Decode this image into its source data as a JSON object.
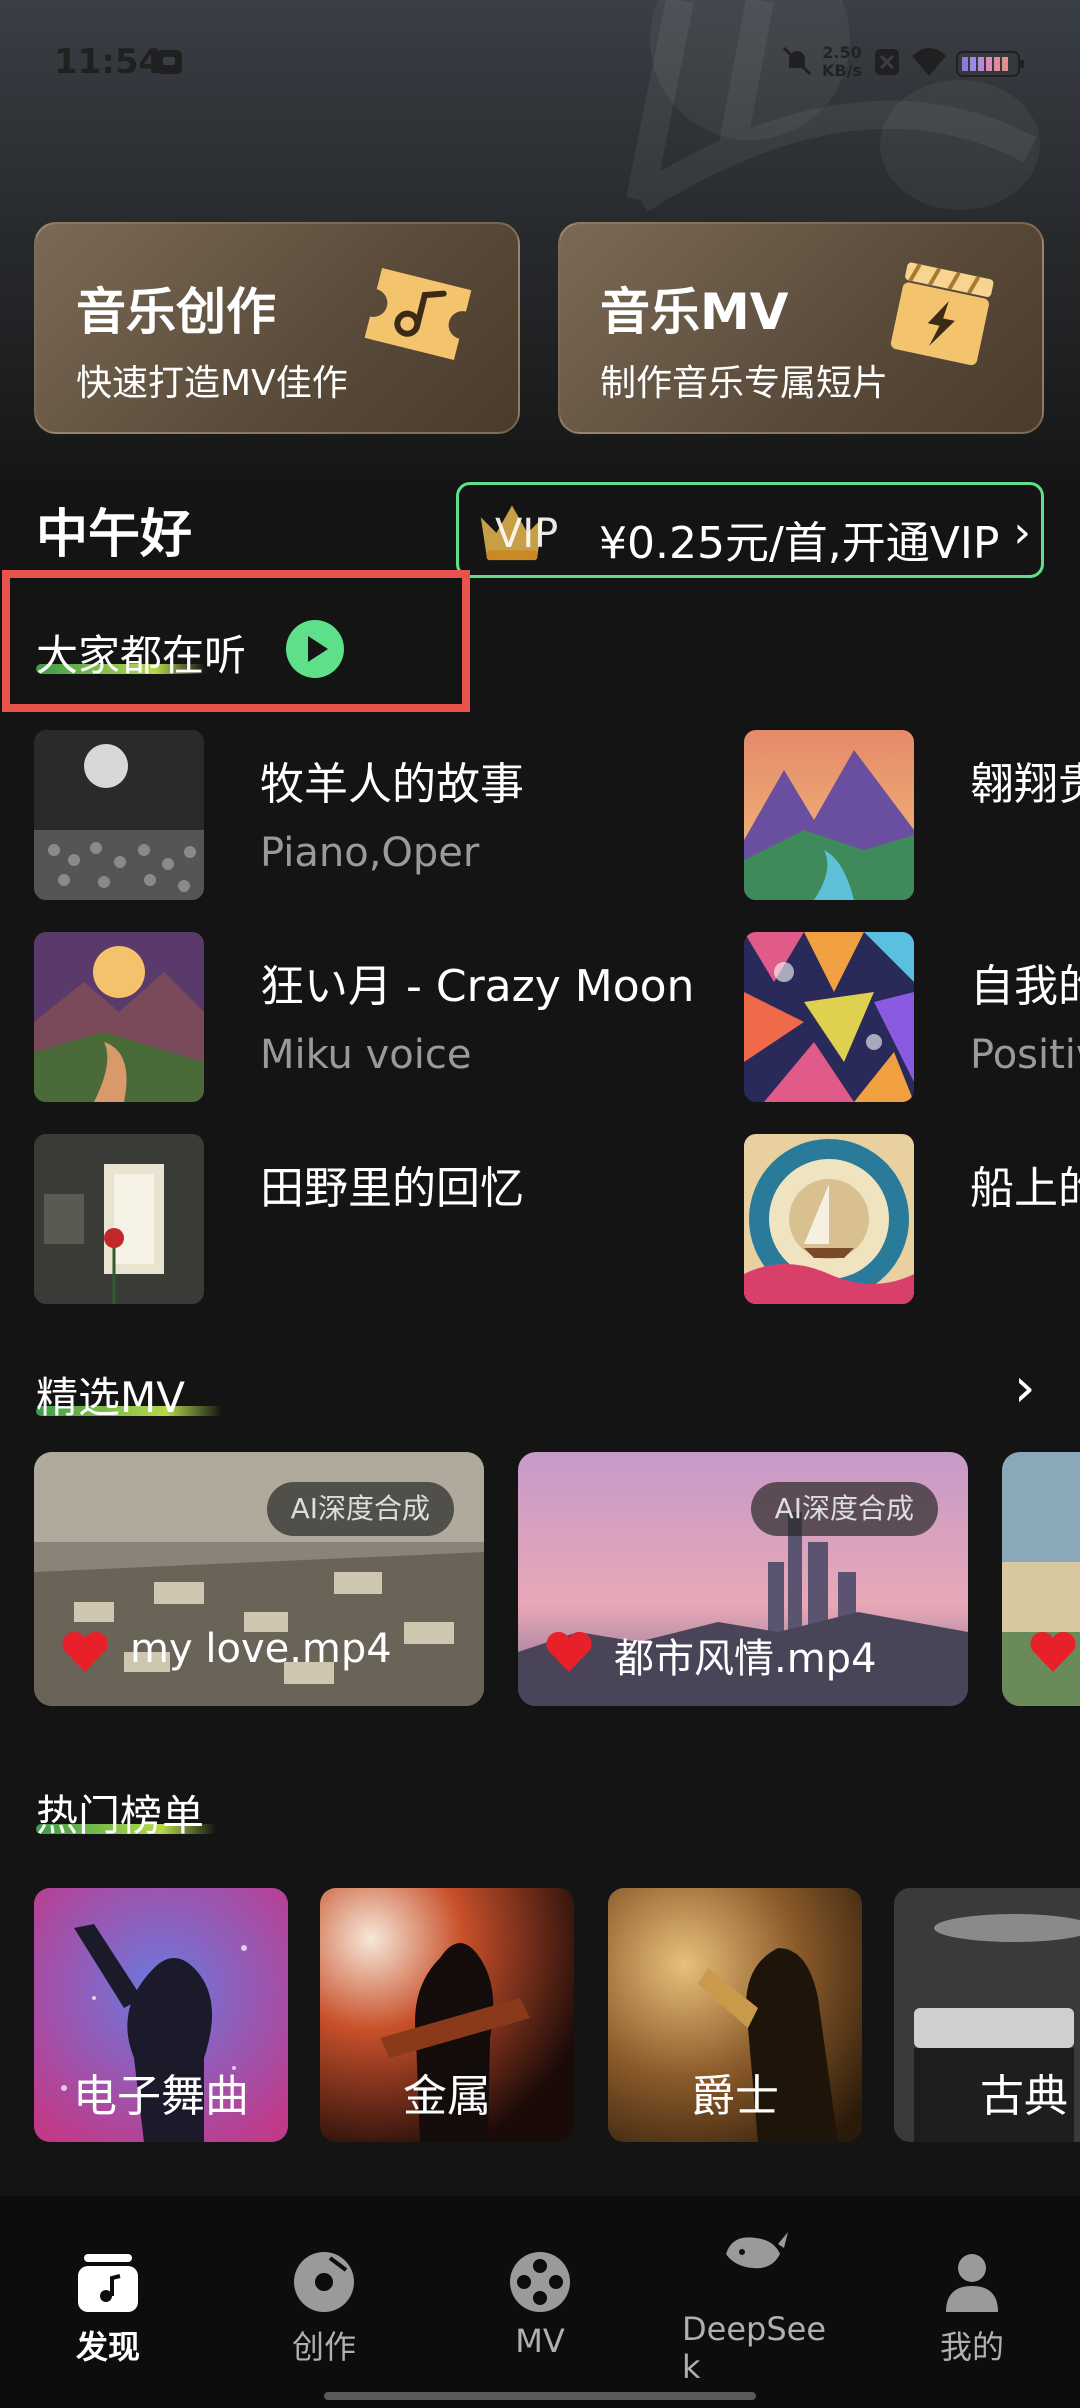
{
  "status": {
    "time": "11:54",
    "net_speed_value": "2.50",
    "net_speed_unit": "KB/s"
  },
  "feature_cards": [
    {
      "title": "音乐创作",
      "subtitle": "快速打造MV佳作",
      "icon": "music-ticket-icon"
    },
    {
      "title": "音乐MV",
      "subtitle": "制作音乐专属短片",
      "icon": "clapperboard-icon"
    }
  ],
  "greeting": "中午好",
  "vip": {
    "tag": "VIP",
    "text": "¥0.25元/首,开通VIP",
    "arrow": "›"
  },
  "listening": {
    "title": "大家都在听"
  },
  "songs": [
    {
      "title": "牧羊人的故事",
      "subtitle": "Piano,Oper"
    },
    {
      "title": "翱翔贵",
      "subtitle": ""
    },
    {
      "title": "狂い月 - Crazy Moon",
      "subtitle": "Miku voice"
    },
    {
      "title": "自我的",
      "subtitle": "Positiv"
    },
    {
      "title": "田野里的回忆",
      "subtitle": ""
    },
    {
      "title": "船上的",
      "subtitle": ""
    }
  ],
  "mv_section": {
    "title": "精选MV",
    "more": "›",
    "items": [
      {
        "name": "my love.mp4",
        "badge": "AI深度合成"
      },
      {
        "name": "都市风情.mp4",
        "badge": "AI深度合成"
      }
    ]
  },
  "charts_section": {
    "title": "热门榜单",
    "items": [
      "电子舞曲",
      "金属",
      "爵士",
      "古典"
    ]
  },
  "tabs": [
    {
      "label": "发现",
      "active": true,
      "icon": "discover-icon"
    },
    {
      "label": "创作",
      "active": false,
      "icon": "disc-icon"
    },
    {
      "label": "MV",
      "active": false,
      "icon": "film-reel-icon"
    },
    {
      "label": "DeepSee\nk",
      "active": false,
      "icon": "whale-icon"
    },
    {
      "label": "我的",
      "active": false,
      "icon": "profile-icon"
    }
  ],
  "colors": {
    "accent_green": "#5ee08a",
    "highlight_red": "#e8524d",
    "background": "#141414"
  }
}
